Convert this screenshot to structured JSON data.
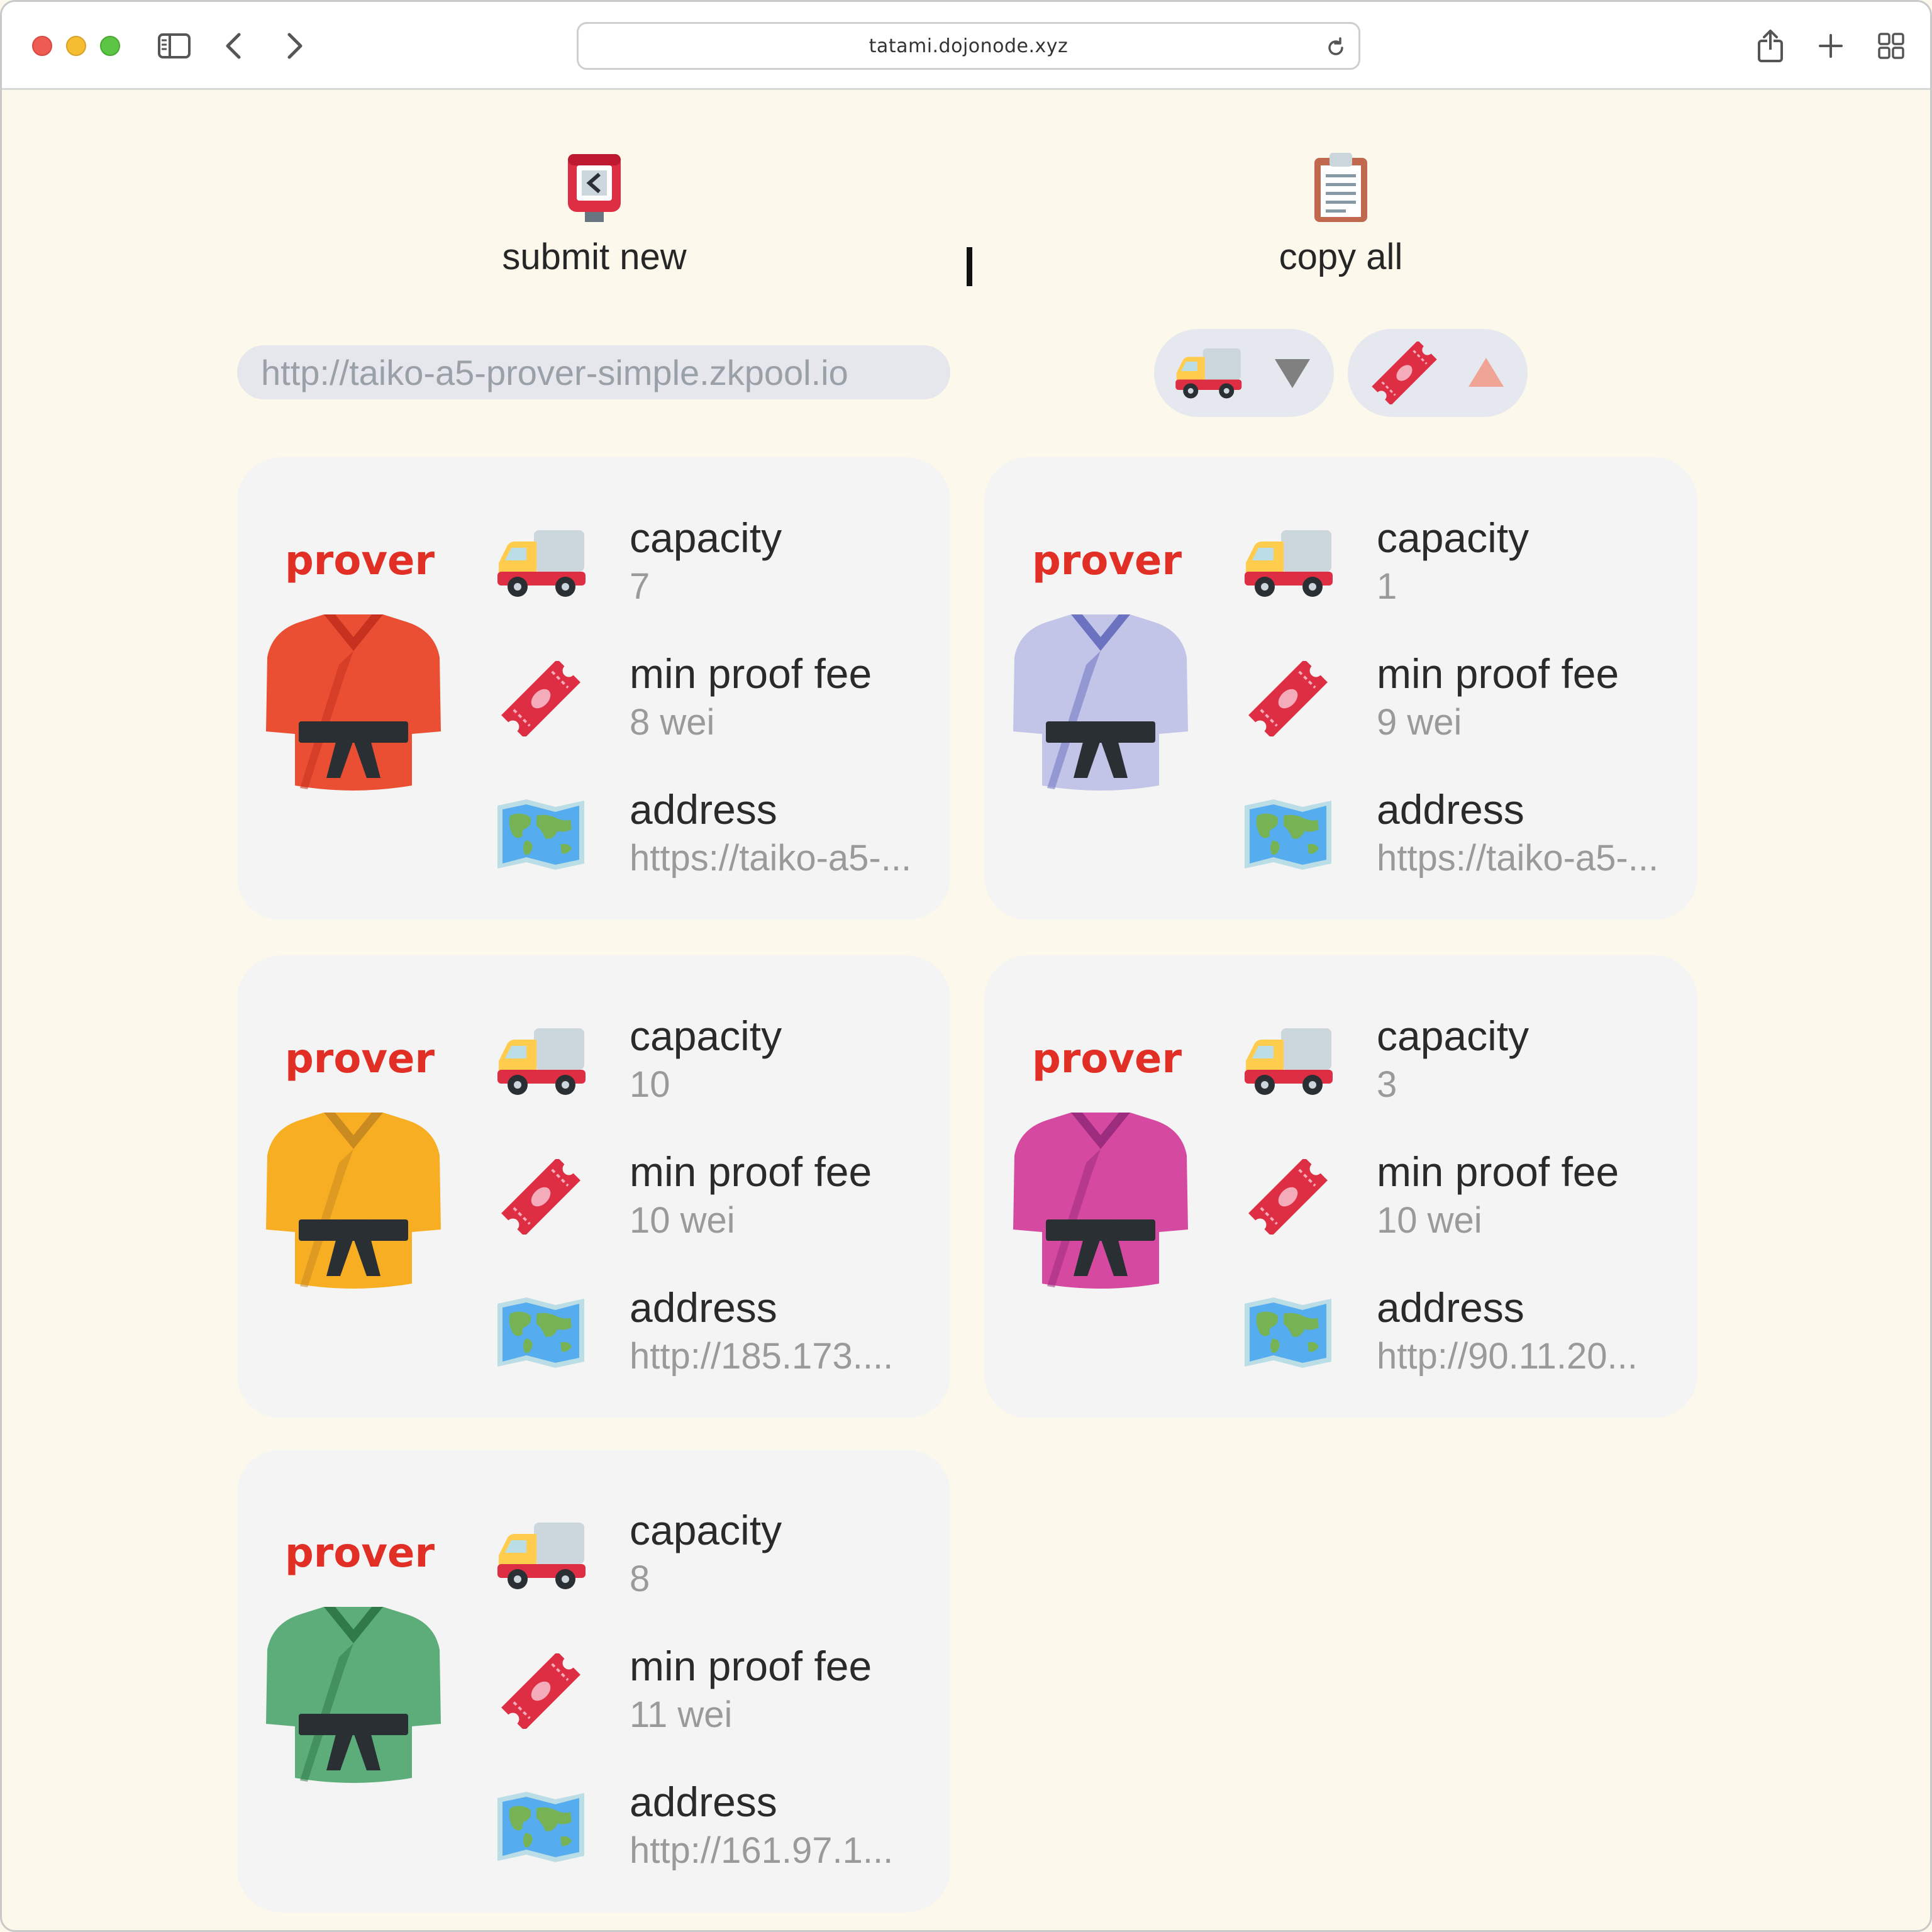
{
  "browser": {
    "url": "tatami.dojonode.xyz"
  },
  "actions": {
    "submit_label": "submit new",
    "copy_label": "copy all"
  },
  "filter": {
    "value": "http://taiko-a5-prover-simple.zkpool.io"
  },
  "sort": {
    "capacity_direction": "descending",
    "fee_direction": "ascending"
  },
  "labels": {
    "prover": "prover",
    "capacity": "capacity",
    "min_fee": "min proof fee",
    "address": "address"
  },
  "provers": [
    {
      "gi_color": "#ea4e33",
      "gi_shade": "#c7311f",
      "capacity": "7",
      "fee": "8 wei",
      "address": "https://taiko-a5-..."
    },
    {
      "gi_color": "#c3c5e8",
      "gi_shade": "#6b73c1",
      "capacity": "1",
      "fee": "9 wei",
      "address": "https://taiko-a5-..."
    },
    {
      "gi_color": "#f8ae22",
      "gi_shade": "#c98a21",
      "capacity": "10",
      "fee": "10 wei",
      "address": "http://185.173...."
    },
    {
      "gi_color": "#d54aa0",
      "gi_shade": "#9c2c7e",
      "capacity": "3",
      "fee": "10 wei",
      "address": "http://90.11.20..."
    },
    {
      "gi_color": "#5cad79",
      "gi_shade": "#2f7a48",
      "capacity": "8",
      "fee": "11 wei",
      "address": "http://161.97.1..."
    }
  ],
  "colors": {
    "page_background": "#fdf8ec",
    "card_background": "#f4f4f4",
    "prover_red": "#e12f25"
  },
  "icons": {
    "submit": "postbox-icon",
    "copy": "clipboard-icon",
    "capacity": "truck-icon",
    "fee": "ticket-icon",
    "address": "world-map-icon",
    "gi": "martial-arts-uniform-icon"
  }
}
